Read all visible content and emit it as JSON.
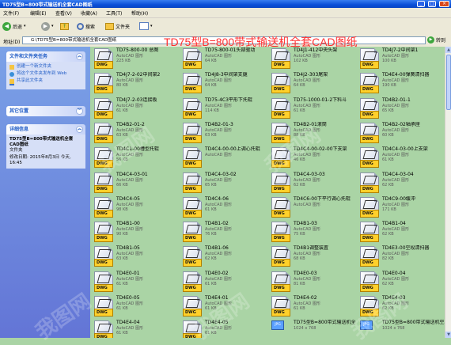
{
  "window": {
    "title": "TD75型B=800带式输送机全套CAD图纸"
  },
  "menu": [
    "文件(F)",
    "编辑(E)",
    "查看(V)",
    "收藏(A)",
    "工具(T)",
    "帮助(H)"
  ],
  "toolbar": {
    "back": "后退",
    "search": "搜索",
    "folders": "文件夹"
  },
  "address": {
    "label": "地址(D)",
    "value": "G:\\TD75型B=800带式输送机全套CAD图纸",
    "go": "转到"
  },
  "overlay_title": "TD75型B=800带式输送机全套CAD图纸",
  "left": {
    "tasks_title": "文件和文件夹任务",
    "tasks": [
      "创建一个新文件夹",
      "将这个文件夹发布到 Web",
      "共享此文件夹"
    ],
    "other_title": "其它位置",
    "details_title": "详细信息",
    "details_name": "TD75型B=800带式输送机全套CAD图纸",
    "details_type": "文件夹",
    "details_modified": "修改日期: 2015年8月3日 今天, 16:45"
  },
  "files": [
    {
      "name": "TD75-800-00 总图",
      "sub": "AutoCAD 图形",
      "size": "225 KB",
      "icon": "dwg-icon"
    },
    {
      "name": "TD75-800-01头部驱动",
      "sub": "AutoCAD 图形",
      "size": "64 KB",
      "icon": "dwg-icon"
    },
    {
      "name": "TD4J1-412中央头架",
      "sub": "AutoCAD 图形",
      "size": "102 KB",
      "icon": "dwg-icon"
    },
    {
      "name": "TD4J7-2中间架1",
      "sub": "AutoCAD 图形",
      "size": "100 KB",
      "icon": "dwg-icon"
    },
    {
      "name": "TD4J7-2-02中间架2",
      "sub": "AutoCAD 图形",
      "size": "80 KB",
      "icon": "dwg-icon"
    },
    {
      "name": "TD4J8-3中间架支腿",
      "sub": "AutoCAD 图形",
      "size": "64 KB",
      "icon": "dwg-icon"
    },
    {
      "name": "TD4J2-303尾架",
      "sub": "AutoCAD 图形",
      "size": "64 KB",
      "icon": "dwg-icon"
    },
    {
      "name": "TD4E4-00弹簧清扫器",
      "sub": "AutoCAD 图形",
      "size": "190 KB",
      "icon": "dwg-icon"
    },
    {
      "name": "TD4J7-2-03连接板",
      "sub": "AutoCAD 图形",
      "size": "61 KB",
      "icon": "dwg-icon"
    },
    {
      "name": "TD75-4C3平形下托辊",
      "sub": "AutoCAD 图形",
      "size": "114 KB",
      "icon": "dwg-icon"
    },
    {
      "name": "TD75-1000-01-2下料斗",
      "sub": "AutoCAD 图形",
      "size": "61 KB",
      "icon": "dwg-icon"
    },
    {
      "name": "TD4B2-01-1",
      "sub": "AutoCAD 图形",
      "size": "65 KB",
      "icon": "dwg-icon"
    },
    {
      "name": "TD4B2-01-2",
      "sub": "AutoCAD 图形",
      "size": "63 KB",
      "icon": "dwg-icon"
    },
    {
      "name": "TD4B2-01-3",
      "sub": "AutoCAD 图形",
      "size": "63 KB",
      "icon": "dwg-icon"
    },
    {
      "name": "TD4B2-01滚筒",
      "sub": "AutoCAD 图形",
      "size": "88 KB",
      "icon": "dwg-icon"
    },
    {
      "name": "TD4B2-02轴承座",
      "sub": "AutoCAD 图形",
      "size": "60 KB",
      "icon": "dwg-icon"
    },
    {
      "name": "TD4C1-00槽型托辊",
      "sub": "AutoCAD 图形",
      "size": "56 KB",
      "icon": "dwg-icon"
    },
    {
      "name": "TD4C4-00-00上调心托辊",
      "sub": "AutoCAD 图形",
      "size": "",
      "icon": "dwg-icon"
    },
    {
      "name": "TD4C4-00-02-00下支架",
      "sub": "AutoCAD 图形",
      "size": "46 KB",
      "icon": "dwg-icon"
    },
    {
      "name": "TD4C4-03-00上支架",
      "sub": "AutoCAD 图形",
      "size": "61 KB",
      "icon": "dwg-icon"
    },
    {
      "name": "TD4C4-03-01",
      "sub": "AutoCAD 图形",
      "size": "66 KB",
      "icon": "dwg-icon"
    },
    {
      "name": "TD4C4-03-02",
      "sub": "AutoCAD 图形",
      "size": "65 KB",
      "icon": "dwg-icon"
    },
    {
      "name": "TD4C4-03-03",
      "sub": "AutoCAD 图形",
      "size": "62 KB",
      "icon": "dwg-icon"
    },
    {
      "name": "TD4C4-03-04",
      "sub": "AutoCAD 图形",
      "size": "62 KB",
      "icon": "dwg-icon"
    },
    {
      "name": "TD4C4-05",
      "sub": "AutoCAD 图形",
      "size": "98 KB",
      "icon": "dwg-icon"
    },
    {
      "name": "TD4C4-06",
      "sub": "AutoCAD 图形",
      "size": "61 KB",
      "icon": "dwg-icon"
    },
    {
      "name": "TD4C6-00下平行调心托辊",
      "sub": "AutoCAD 图形",
      "size": "",
      "icon": "dwg-icon"
    },
    {
      "name": "TD4C9-00缓冲",
      "sub": "AutoCAD 图形",
      "size": "171 KB",
      "icon": "dwg-icon"
    },
    {
      "name": "TD4B1-00",
      "sub": "AutoCAD 图形",
      "size": "90 KB",
      "icon": "dwg-icon"
    },
    {
      "name": "TD4B1-02",
      "sub": "AutoCAD 图形",
      "size": "76 KB",
      "icon": "dwg-icon"
    },
    {
      "name": "TD4B1-03",
      "sub": "AutoCAD 图形",
      "size": "75 KB",
      "icon": "dwg-icon"
    },
    {
      "name": "TD4B1-04",
      "sub": "AutoCAD 图形",
      "size": "62 KB",
      "icon": "dwg-icon"
    },
    {
      "name": "TD4B1-05",
      "sub": "AutoCAD 图形",
      "size": "63 KB",
      "icon": "dwg-icon"
    },
    {
      "name": "TD4B1-06",
      "sub": "AutoCAD 图形",
      "size": "62 KB",
      "icon": "dwg-icon"
    },
    {
      "name": "TD4B1调整装置",
      "sub": "AutoCAD 图形",
      "size": "68 KB",
      "icon": "dwg-icon"
    },
    {
      "name": "TD4E3-00空段清扫器",
      "sub": "AutoCAD 图形",
      "size": "82 KB",
      "icon": "dwg-icon"
    },
    {
      "name": "TD4E0-01",
      "sub": "AutoCAD 图形",
      "size": "61 KB",
      "icon": "dwg-icon"
    },
    {
      "name": "TD4E0-02",
      "sub": "AutoCAD 图形",
      "size": "61 KB",
      "icon": "dwg-icon"
    },
    {
      "name": "TD4E0-03",
      "sub": "AutoCAD 图形",
      "size": "81 KB",
      "icon": "dwg-icon"
    },
    {
      "name": "TD4E0-04",
      "sub": "AutoCAD 图形",
      "size": "62 KB",
      "icon": "dwg-icon"
    },
    {
      "name": "TD4E0-05",
      "sub": "AutoCAD 图形",
      "size": "61 KB",
      "icon": "dwg-icon"
    },
    {
      "name": "TD4E4-01",
      "sub": "AutoCAD 图形",
      "size": "61 KB",
      "icon": "dwg-icon"
    },
    {
      "name": "TD4E4-02",
      "sub": "AutoCAD 图形",
      "size": "61 KB",
      "icon": "dwg-icon"
    },
    {
      "name": "TD4E4-03",
      "sub": "AutoCAD 图形",
      "size": "62 KB",
      "icon": "dwg-icon"
    },
    {
      "name": "TD4E4-04",
      "sub": "AutoCAD 图形",
      "size": "61 KB",
      "icon": "dwg-icon"
    },
    {
      "name": "TD4E4-05",
      "sub": "AutoCAD 图形",
      "size": "61 KB",
      "icon": "dwg-icon"
    },
    {
      "name": "TD75型B=800带式输送机全套",
      "sub": "1024 x 768",
      "size": "",
      "icon": "jpg-icon"
    },
    {
      "name": "TD75型B=800带式输送机空段清扫器",
      "sub": "1024 x 768",
      "size": "",
      "icon": "jpg-icon"
    }
  ]
}
